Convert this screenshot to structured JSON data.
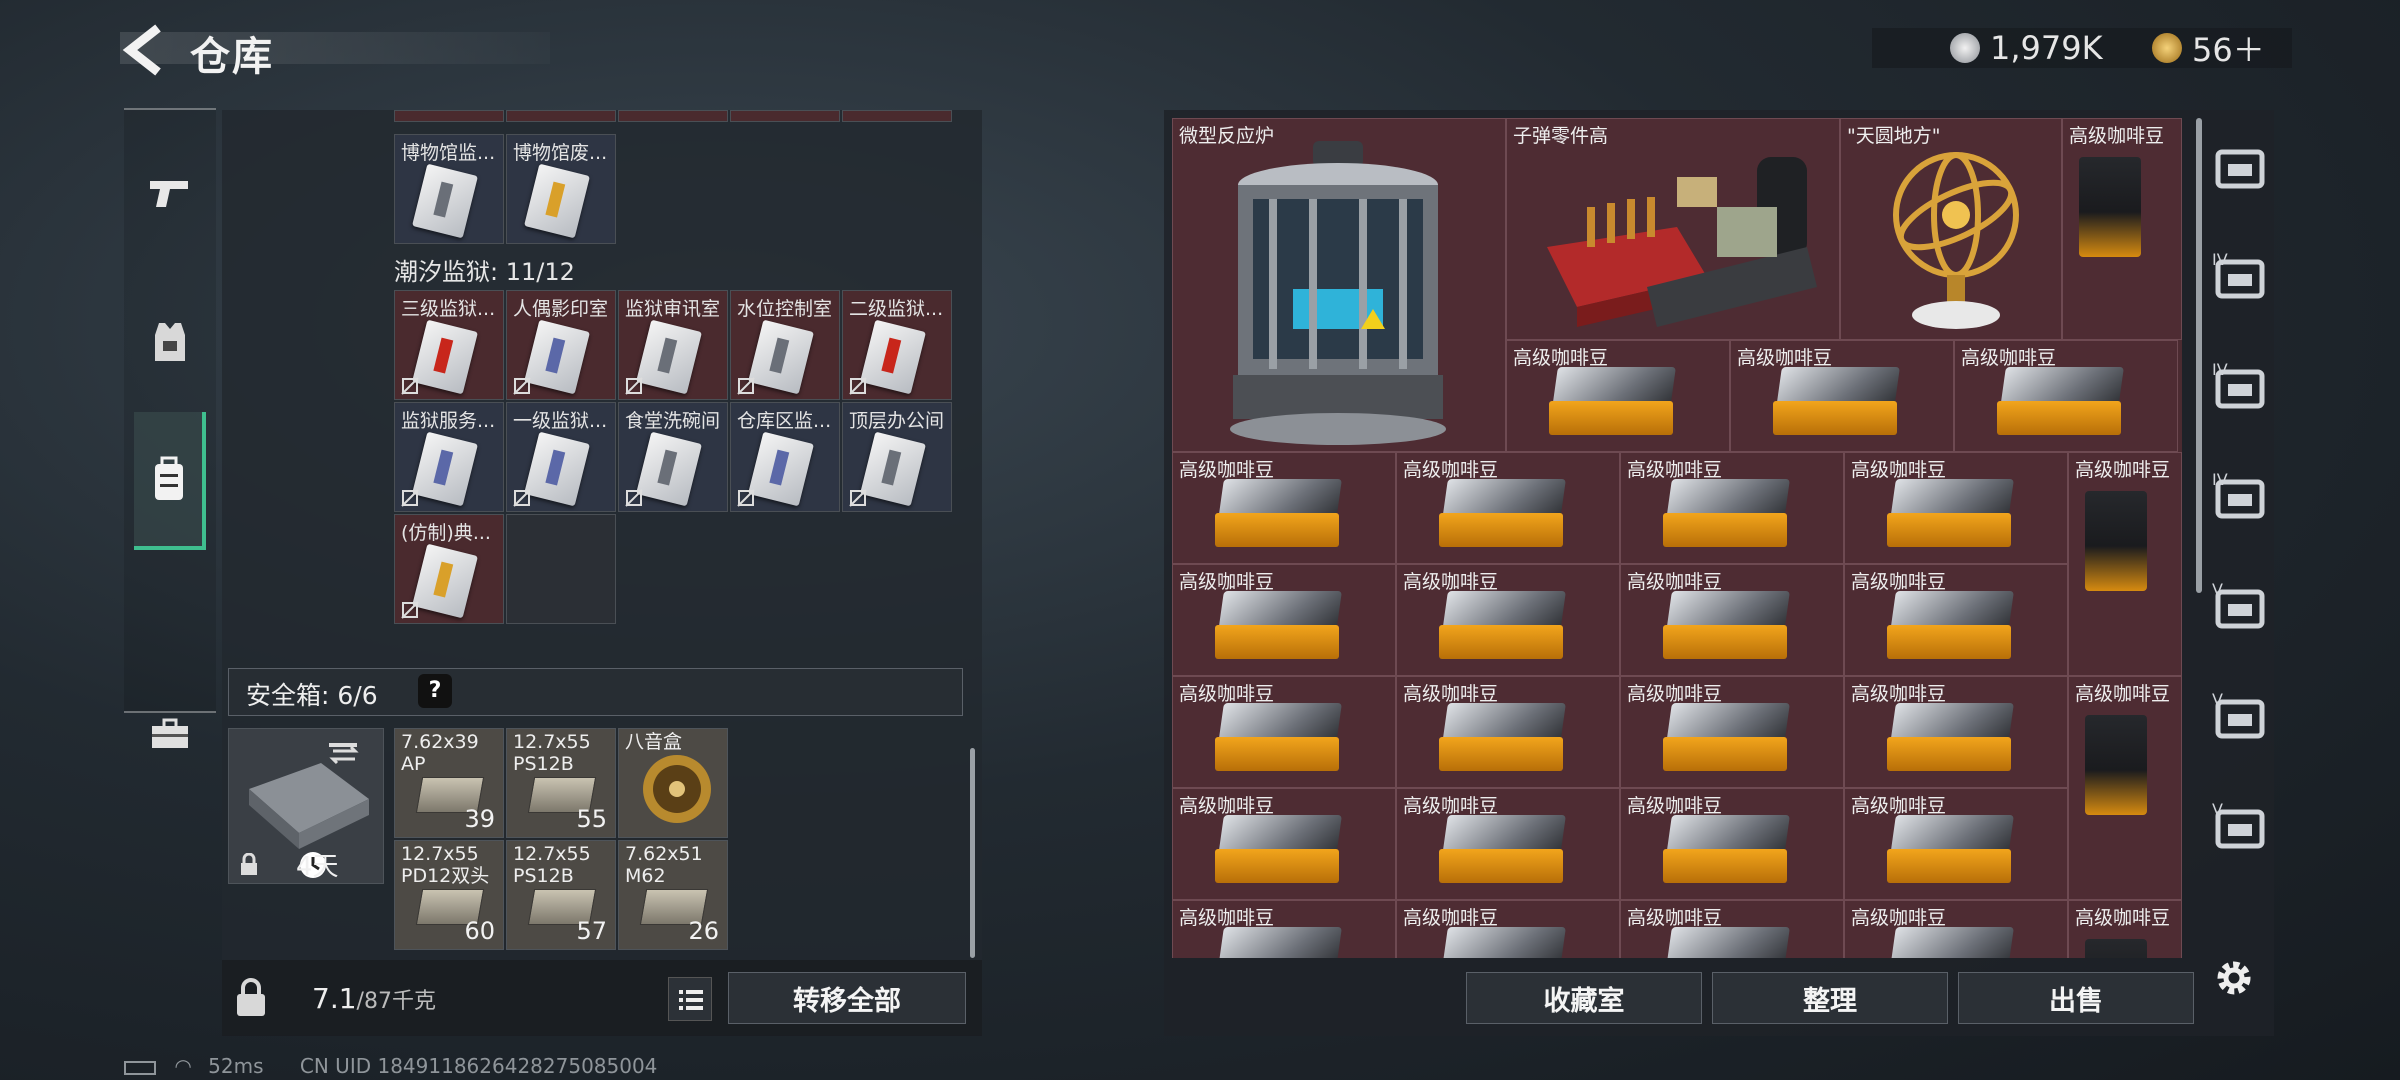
{
  "header": {
    "title": "仓库"
  },
  "currency": [
    {
      "amount": "1,979K",
      "icon": "silver-coin-icon",
      "color": "#c9ccd1"
    },
    {
      "amount": "56＋",
      "icon": "gold-coin-icon",
      "color": "#d9a441"
    }
  ],
  "left_nav": [
    {
      "icon": "pistol-icon"
    },
    {
      "icon": "armor-vest-icon"
    },
    {
      "icon": "backpack-icon",
      "active": true
    },
    {
      "icon": "briefcase-icon"
    }
  ],
  "storage": {
    "top_row": [
      "博物馆监...",
      "博物馆废..."
    ],
    "section_title": "潮汐监狱: 11/12",
    "cards": [
      {
        "label": "三级监狱...",
        "bg": "red",
        "stripe": "#c8261b"
      },
      {
        "label": "人偶影印室",
        "bg": "red",
        "stripe": "#5b68a8"
      },
      {
        "label": "监狱审讯室",
        "bg": "red",
        "stripe": "#6a6f78"
      },
      {
        "label": "水位控制室",
        "bg": "red",
        "stripe": "#6a6f78"
      },
      {
        "label": "二级监狱...",
        "bg": "red",
        "stripe": "#c8261b"
      },
      {
        "label": "监狱服务...",
        "bg": "blue",
        "stripe": "#5b68a8"
      },
      {
        "label": "一级监狱...",
        "bg": "blue",
        "stripe": "#5b68a8"
      },
      {
        "label": "食堂洗碗间",
        "bg": "blue",
        "stripe": "#6a6f78"
      },
      {
        "label": "仓库区监...",
        "bg": "blue",
        "stripe": "#5b68a8"
      },
      {
        "label": "顶层办公间",
        "bg": "blue",
        "stripe": "#6a6f78"
      },
      {
        "label": "(仿制)典...",
        "bg": "red",
        "stripe": "#d9a02a"
      }
    ]
  },
  "safe_box": {
    "label": "安全箱: 6/6",
    "help": "?",
    "days": "4天",
    "items": [
      {
        "label": "7.62x39\nAP",
        "count": "39"
      },
      {
        "label": "12.7x55\nPS12B",
        "count": "55"
      },
      {
        "label": "八音盒",
        "count": ""
      },
      {
        "label": "12.7x55\nPD12双头",
        "count": "60"
      },
      {
        "label": "12.7x55\nPS12B",
        "count": "57"
      },
      {
        "label": "7.62x51\nM62",
        "count": "26"
      }
    ]
  },
  "weight": {
    "current": "7.1",
    "max": "/87千克"
  },
  "buttons": {
    "transfer_all": "转移全部",
    "collection": "收藏室",
    "organize": "整理",
    "sell": "出售"
  },
  "warehouse": {
    "big_items": [
      {
        "label": "微型反应炉"
      },
      {
        "label": "子弹零件高"
      },
      {
        "label": "\"天圆地方\""
      }
    ],
    "coffee_label": "高级咖啡豆"
  },
  "right_tabs": [
    {
      "icon": "helmet-shelf-icon",
      "level": ""
    },
    {
      "icon": "armory-iv-icon",
      "level": "IV"
    },
    {
      "icon": "folder-iv-icon",
      "level": "IV"
    },
    {
      "icon": "medkit-iv-icon",
      "level": "IV"
    },
    {
      "icon": "toolbox-v-icon",
      "level": "V"
    },
    {
      "icon": "gear-case-v-icon",
      "level": "V"
    },
    {
      "icon": "camera-v-icon",
      "level": "V"
    }
  ],
  "status_bar": {
    "ping": "52ms",
    "uid": "CN UID 1849118626428275085004"
  }
}
